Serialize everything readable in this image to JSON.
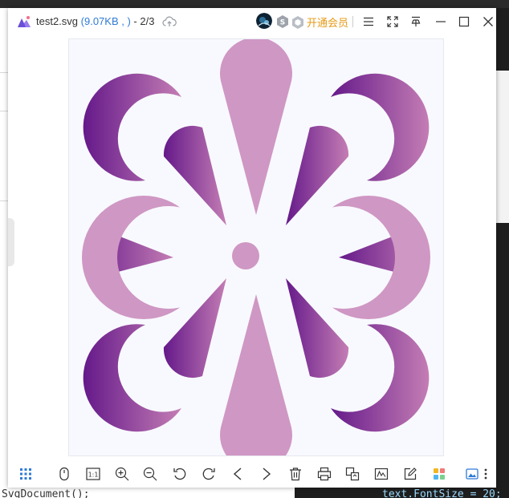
{
  "window": {
    "file_name": "test2.svg",
    "file_meta": "(9.07KB , )",
    "page_counter": "- 2/3",
    "vip_label": "开通会员"
  },
  "icons": {
    "app": "picture-viewer-logo",
    "upload": "cloud-upload-icon",
    "avatar": "user-avatar",
    "badges": [
      "s-badge-icon",
      "hex-badge-icon"
    ],
    "titlebar_controls": [
      "menu-icon",
      "fullscreen-icon",
      "pin-icon",
      "minimize-icon",
      "maximize-icon",
      "close-icon"
    ],
    "toolbar": [
      "grid-icon",
      "mouse-icon",
      "actual-size-icon",
      "zoom-in-icon",
      "zoom-out-icon",
      "rotate-left-icon",
      "rotate-right-icon",
      "prev-icon",
      "next-icon",
      "delete-icon",
      "print-icon",
      "convert-icon",
      "edit-image-icon",
      "annotate-icon",
      "apps-icon",
      "wallpaper-icon",
      "more-icon"
    ]
  },
  "toolbar": {
    "actual_size_label": "1:1"
  },
  "background": {
    "code_left": "SvgDocument();",
    "code_right": "text.FontSize = 20;"
  },
  "colors": {
    "accent": "#2f7ad6",
    "vip": "#e59a17",
    "petal_light": "#cf97c4",
    "gradient_dark": "#65198a",
    "gradient_light": "#c076b0"
  }
}
